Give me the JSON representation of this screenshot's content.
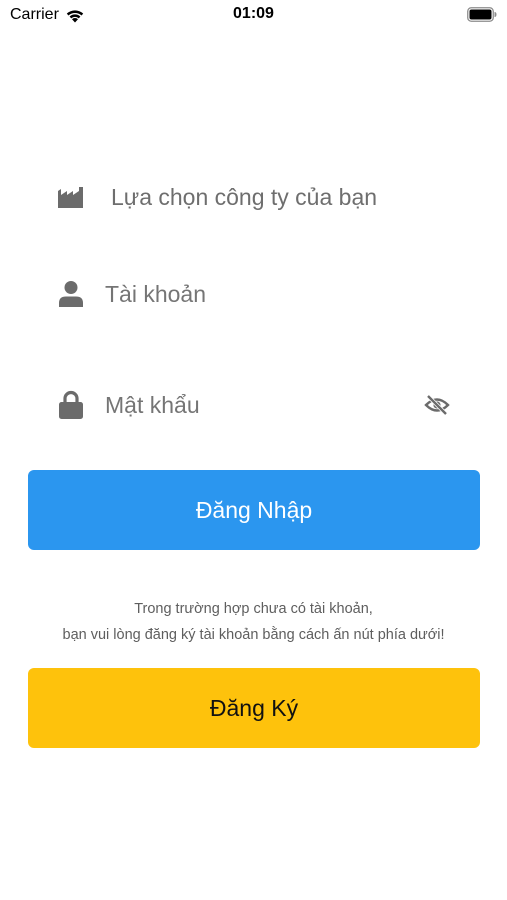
{
  "status_bar": {
    "carrier": "Carrier",
    "time": "01:09"
  },
  "form": {
    "company_placeholder": "Lựa chọn công ty của bạn",
    "account_placeholder": "Tài khoản",
    "password_placeholder": "Mật khẩu"
  },
  "buttons": {
    "login_label": "Đăng Nhập",
    "register_label": "Đăng Ký"
  },
  "info": {
    "line1": "Trong trường hợp chưa có tài khoản,",
    "line2": "bạn vui lòng đăng ký tài khoản bằng cách ấn nút phía dưới!"
  },
  "colors": {
    "login_button": "#2b96ef",
    "register_button": "#fec20c",
    "placeholder_text": "#6e6e6e",
    "icon": "#6b6b6b"
  },
  "icons": {
    "company": "factory-icon",
    "account": "person-icon",
    "password": "lock-icon",
    "visibility": "eye-off-icon",
    "wifi": "wifi-icon",
    "battery": "battery-icon"
  }
}
